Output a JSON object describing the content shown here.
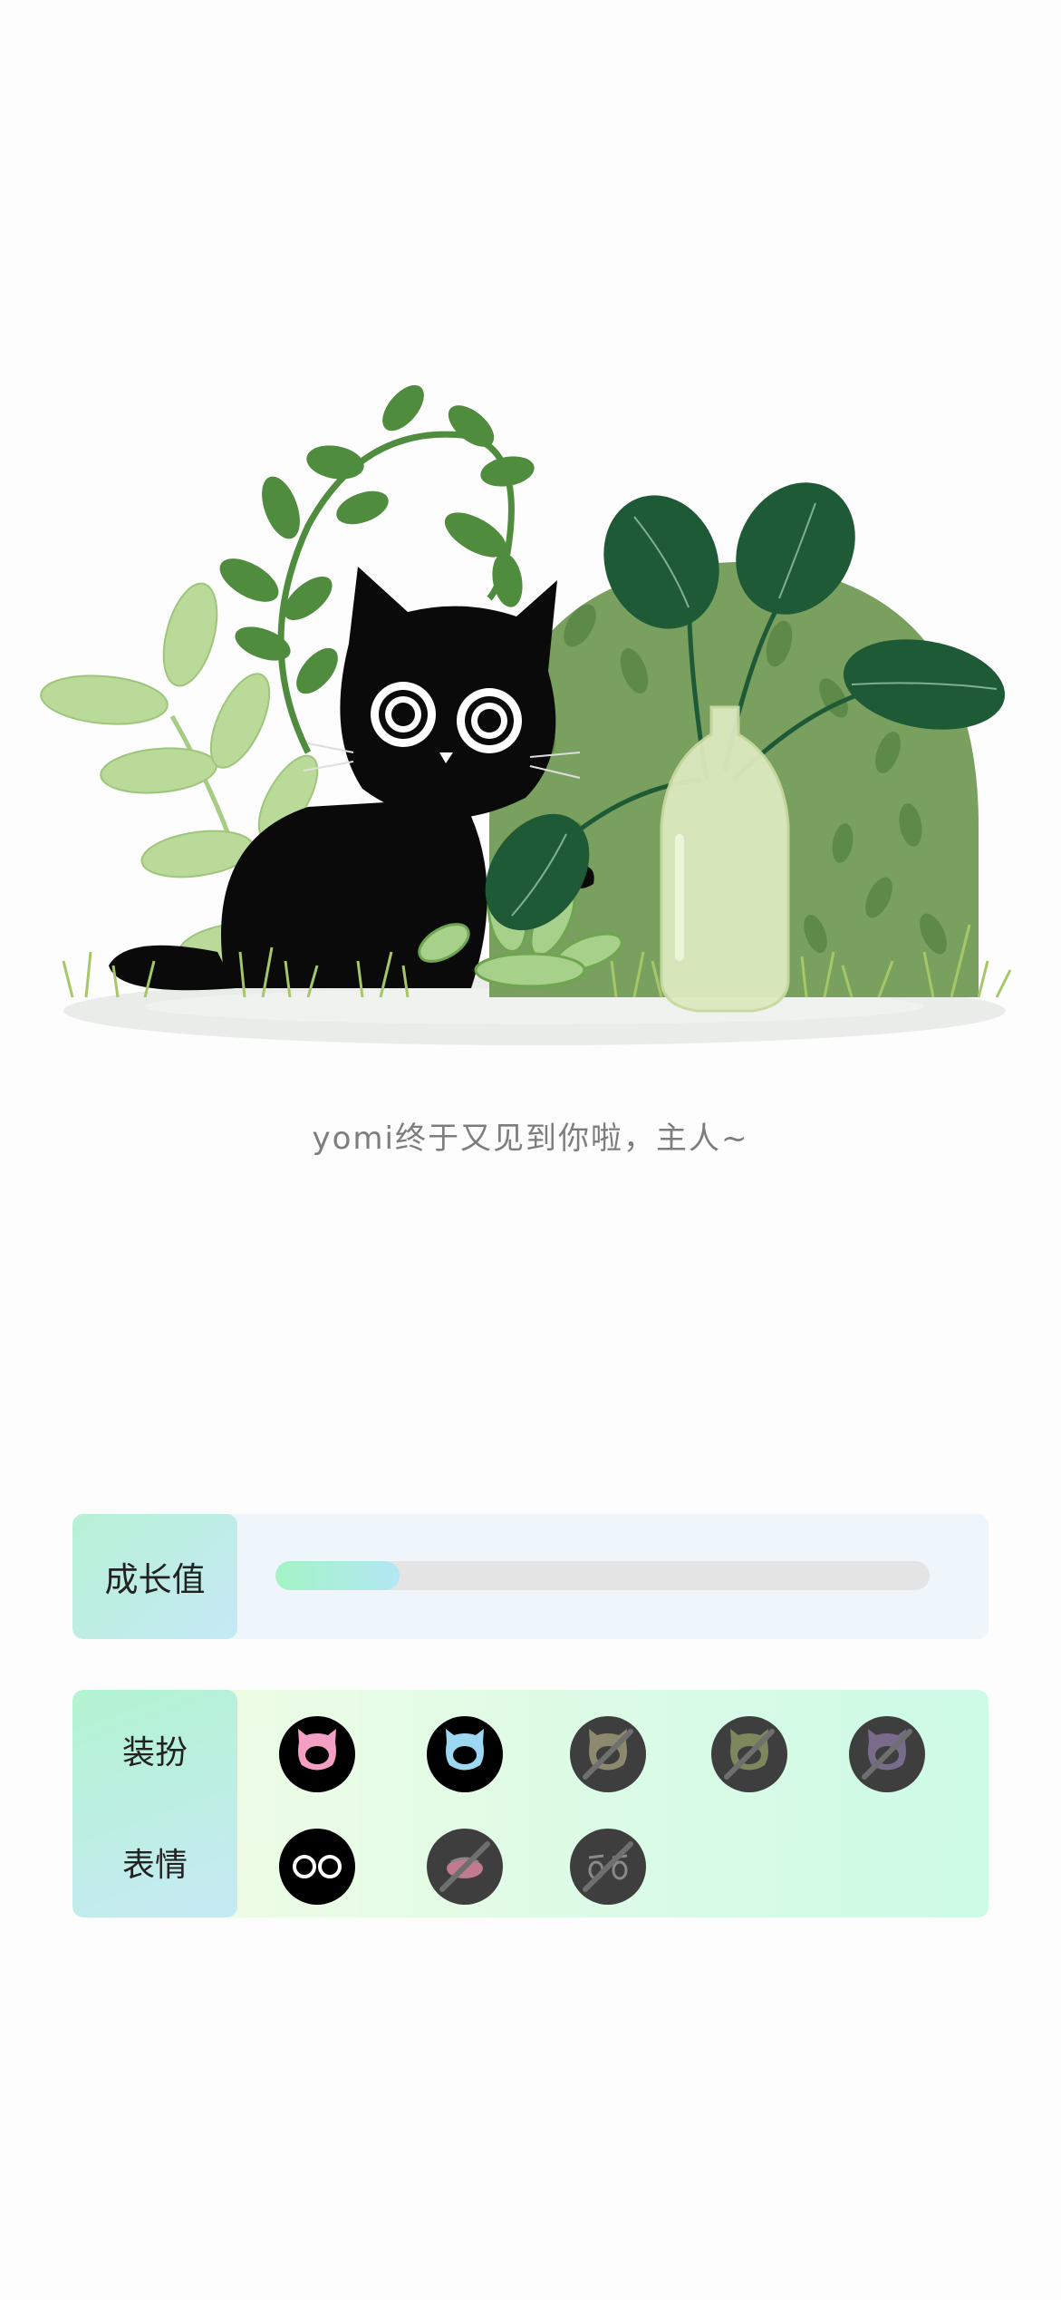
{
  "scene": {
    "greeting": "yomi终于又见到你啦，主人~"
  },
  "growth": {
    "label": "成长值",
    "progress": 0.19,
    "colors": {
      "from": "#a4f4c6",
      "to": "#b2e7f3",
      "track": "#e4e4e4"
    }
  },
  "customize": {
    "dress_label": "装扮",
    "face_label": "表情",
    "dress_options": [
      {
        "name": "pink-cat",
        "color": "#f59fc4",
        "locked": false
      },
      {
        "name": "blue-cat",
        "color": "#9cd8f2",
        "locked": false
      },
      {
        "name": "beige-cat",
        "color": "#a8a37f",
        "locked": true
      },
      {
        "name": "olive-cat",
        "color": "#93a069",
        "locked": true
      },
      {
        "name": "purple-cat",
        "color": "#8c7ba5",
        "locked": true
      }
    ],
    "face_options": [
      {
        "name": "round-eyes",
        "locked": false
      },
      {
        "name": "blush-mouth",
        "locked": true
      },
      {
        "name": "sleepy-eyes",
        "locked": true
      }
    ]
  }
}
